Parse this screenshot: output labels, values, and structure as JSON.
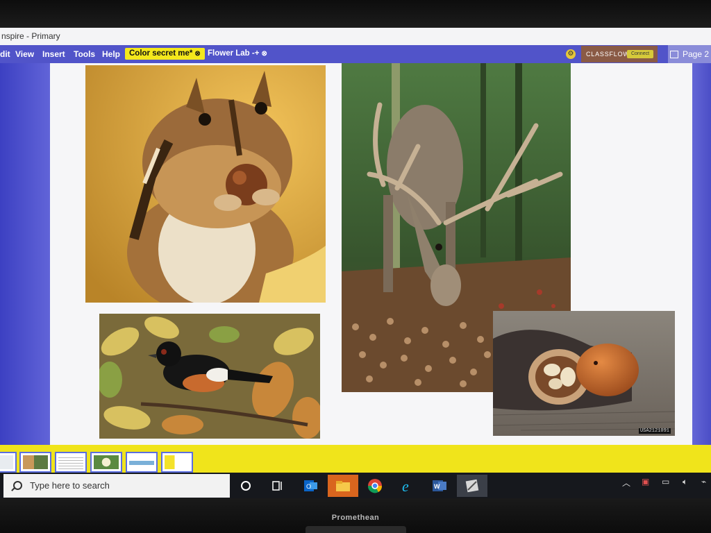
{
  "window": {
    "title": "nspire - Primary"
  },
  "menu": {
    "items": [
      "dit",
      "View",
      "Insert",
      "Tools",
      "Help"
    ]
  },
  "flipchart_tabs": [
    {
      "label": "Color secret me*",
      "active": true
    },
    {
      "label": "Flower Lab -+",
      "active": false
    }
  ],
  "classflow": {
    "label": "CLASSFLOW",
    "connect_label": "Connect"
  },
  "page_indicator": {
    "label": "Page 2"
  },
  "canvas": {
    "photo_id": "USA2121091"
  },
  "page_sorter": {
    "thumbnail_count": 6
  },
  "taskbar": {
    "search_placeholder": "Type here to search",
    "apps": [
      "cortana-circle",
      "task-view",
      "outlook",
      "file-explorer",
      "chrome",
      "internet-explorer",
      "word",
      "activinspire"
    ]
  },
  "bezel": {
    "brand": "Promethean"
  },
  "colors": {
    "menu_bar": "#5154c9",
    "active_tab": "#f4e81c",
    "page_sorter": "#f0e41b",
    "canvas": "#f6f6f8"
  }
}
